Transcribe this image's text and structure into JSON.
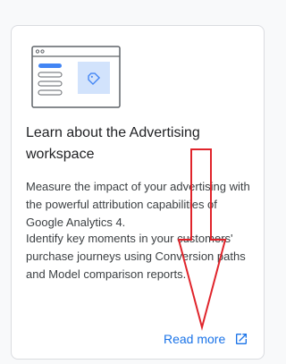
{
  "card": {
    "title": "Learn about the Advertising workspace",
    "description_1": "Measure the impact of your advertising with the powerful attribution capabilities of Google Analytics 4.",
    "description_2": "Identify key moments in your customers' purchase journeys using Conversion paths and Model comparison reports.",
    "link_label": "Read more",
    "link_icon": "open-in-new-icon",
    "illustration_icon": "tag-icon"
  },
  "colors": {
    "link": "#1a73e8",
    "annotation_arrow": "#e0242b",
    "illustration_accent": "#4285f4",
    "illustration_panel": "#d2e3fc"
  }
}
